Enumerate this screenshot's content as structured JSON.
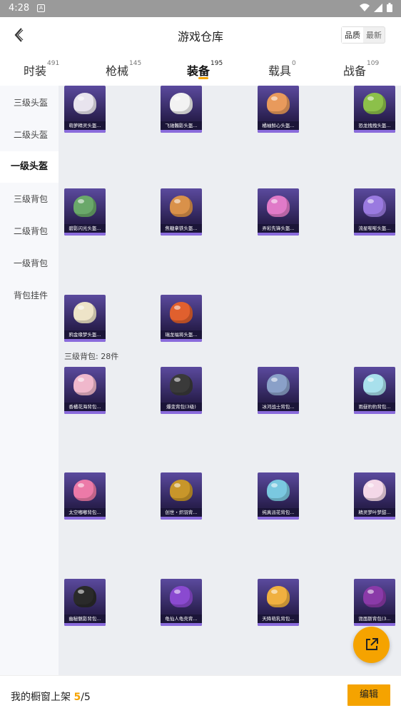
{
  "status_bar": {
    "time": "4:28",
    "notification_letter": "A"
  },
  "header": {
    "title": "游戏仓库",
    "sort_options": [
      "品质",
      "最新"
    ],
    "sort_selected": "品质"
  },
  "tabs": [
    {
      "label": "时装",
      "count": "491"
    },
    {
      "label": "枪械",
      "count": "145"
    },
    {
      "label": "装备",
      "count": "195"
    },
    {
      "label": "载具",
      "count": "0"
    },
    {
      "label": "战备",
      "count": "109"
    }
  ],
  "sidebar": [
    "三级头盔",
    "二级头盔",
    "一级头盔",
    "三级背包",
    "二级背包",
    "一级背包",
    "背包挂件"
  ],
  "sidebar_active": "一级头盔",
  "sections": {
    "helmets": [
      {
        "name": "萌萝精灵头盔...",
        "color": "#e8e4ee"
      },
      {
        "name": "飞驰髑影头盔...",
        "color": "#f2f2f2"
      },
      {
        "name": "橘袖鲜心头盔...",
        "color": "#e89a5c"
      },
      {
        "name": "恐龙拽拽头盔...",
        "color": "#8cc04a"
      },
      {
        "name": "碧影闪光头盔...",
        "color": "#6aa86a"
      },
      {
        "name": "焦糖拿铁头盔...",
        "color": "#d9914a"
      },
      {
        "name": "弄彩先锋头盔...",
        "color": "#e07ac8"
      },
      {
        "name": "流星嘭嘭头盔...",
        "color": "#9a7ae0"
      },
      {
        "name": "鸦金缘梦头盔...",
        "color": "#eee4c8"
      },
      {
        "name": "瑞龙福将头盔...",
        "color": "#e0602e"
      }
    ],
    "backpacks_label": "三级背包: 28件",
    "backpacks": [
      {
        "name": "香橘花海背包...",
        "color": "#f0b8cc"
      },
      {
        "name": "爆变背包(3级)",
        "color": "#3a3a3a"
      },
      {
        "name": "冰河战士背包...",
        "color": "#8aa0c8"
      },
      {
        "name": "雨昼豹豹背包...",
        "color": "#a8e0ec"
      },
      {
        "name": "太空嘟嘟背包...",
        "color": "#ec7aa8"
      },
      {
        "name": "创世・炽羽背...",
        "color": "#c8962a"
      },
      {
        "name": "纯真派花背包...",
        "color": "#7ac8e0"
      },
      {
        "name": "精灵梦叶梦甜...",
        "color": "#f4d8e8"
      },
      {
        "name": "幽秘魅影背包...",
        "color": "#2a2a2a"
      },
      {
        "name": "龟仙人龟壳背...",
        "color": "#8a4ad0"
      },
      {
        "name": "天降萌乳背包...",
        "color": "#f0b040"
      },
      {
        "name": "诡面斯背包(3...",
        "color": "#8a3aa8"
      }
    ]
  },
  "bottom_bar": {
    "prefix": "我的橱窗上架",
    "current": "5",
    "slash": "/",
    "total": "5",
    "edit_label": "编辑"
  },
  "colors": {
    "accent": "#f5a300",
    "card_bg": "#3a2e70",
    "rarity_purple": "#8a6bdc"
  },
  "icons": {
    "back": "back-arrow-icon",
    "fab": "share-external-icon"
  }
}
